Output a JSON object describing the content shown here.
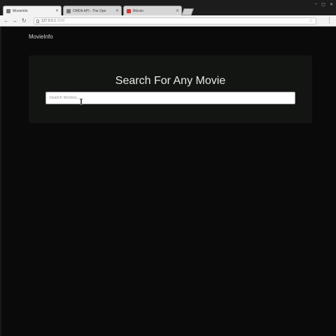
{
  "browser": {
    "tabs": [
      {
        "title": "MovieInfo",
        "active": true,
        "favicon": "page-icon"
      },
      {
        "title": "OMDb API - The Ope",
        "active": false,
        "favicon": "page-icon"
      },
      {
        "title": "Bitcoin",
        "active": false,
        "favicon": "red-app-icon"
      }
    ],
    "new_tab_icon": "new-tab-icon",
    "url": {
      "host": "127.0.0.1",
      "port": ":3000"
    },
    "bookmark_icon": "star-icon"
  },
  "page": {
    "brand": "MovieInfo",
    "heading": "Search For Any Movie",
    "search": {
      "placeholder": "Search Movies...",
      "value": ""
    }
  },
  "colors": {
    "page_background": "#0a0a0a",
    "jumbotron_background": "#131513",
    "heading_text": "#e8e8e8"
  }
}
